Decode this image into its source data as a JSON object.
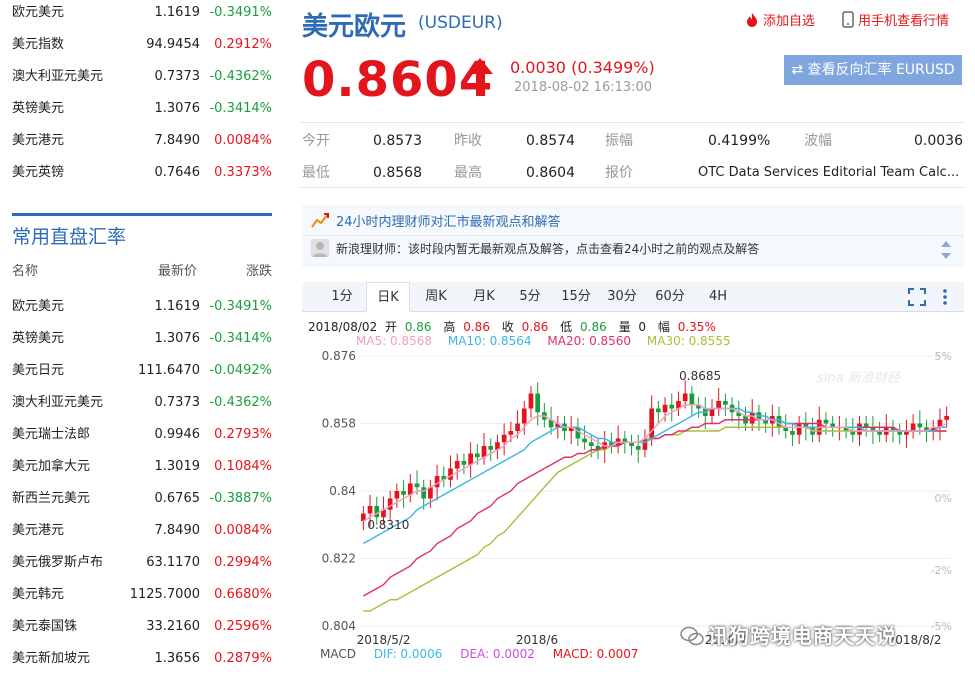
{
  "top_rates": [
    {
      "name": "欧元美元",
      "price": "1.1619",
      "change": "-0.3491%",
      "dir": "down"
    },
    {
      "name": "美元指数",
      "price": "94.9454",
      "change": "0.2912%",
      "dir": "up"
    },
    {
      "name": "澳大利亚元美元",
      "price": "0.7373",
      "change": "-0.4362%",
      "dir": "down"
    },
    {
      "name": "英镑美元",
      "price": "1.3076",
      "change": "-0.3414%",
      "dir": "down"
    },
    {
      "name": "美元港元",
      "price": "7.8490",
      "change": "0.0084%",
      "dir": "up"
    },
    {
      "name": "美元英镑",
      "price": "0.7646",
      "change": "0.3373%",
      "dir": "up"
    }
  ],
  "section_title": "常用直盘汇率",
  "columns": {
    "name": "名称",
    "price": "最新价",
    "change": "涨跌"
  },
  "direct_rates": [
    {
      "name": "欧元美元",
      "price": "1.1619",
      "change": "-0.3491%",
      "dir": "down"
    },
    {
      "name": "英镑美元",
      "price": "1.3076",
      "change": "-0.3414%",
      "dir": "down"
    },
    {
      "name": "美元日元",
      "price": "111.6470",
      "change": "-0.0492%",
      "dir": "down"
    },
    {
      "name": "澳大利亚元美元",
      "price": "0.7373",
      "change": "-0.4362%",
      "dir": "down"
    },
    {
      "name": "美元瑞士法郎",
      "price": "0.9946",
      "change": "0.2793%",
      "dir": "up"
    },
    {
      "name": "美元加拿大元",
      "price": "1.3019",
      "change": "0.1084%",
      "dir": "up"
    },
    {
      "name": "新西兰元美元",
      "price": "0.6765",
      "change": "-0.3887%",
      "dir": "down"
    },
    {
      "name": "美元港元",
      "price": "7.8490",
      "change": "0.0084%",
      "dir": "up"
    },
    {
      "name": "美元俄罗斯卢布",
      "price": "63.1170",
      "change": "0.2994%",
      "dir": "up"
    },
    {
      "name": "美元韩元",
      "price": "1125.7000",
      "change": "0.6680%",
      "dir": "up"
    },
    {
      "name": "美元泰国铢",
      "price": "33.2160",
      "change": "0.2596%",
      "dir": "up"
    },
    {
      "name": "美元新加坡元",
      "price": "1.3656",
      "change": "0.2879%",
      "dir": "up"
    }
  ],
  "header": {
    "title": "美元欧元",
    "code": "(USDEUR)",
    "add_fav": "添加自选",
    "mobile": "用手机查看行情"
  },
  "quote": {
    "price": "0.8604",
    "change": "0.0030 (0.3499%)",
    "datetime": "2018-08-02 16:13:00",
    "reverse_btn": "⇄ 查看反向汇率 EURUSD"
  },
  "stats": {
    "open_label": "今开",
    "open": "0.8573",
    "prev_close_label": "昨收",
    "prev_close": "0.8574",
    "amplitude_label": "振幅",
    "amplitude": "0.4199%",
    "wave_label": "波幅",
    "wave": "0.0036",
    "low_label": "最低",
    "low": "0.8568",
    "high_label": "最高",
    "high": "0.8604",
    "quote_label": "报价",
    "quote_src": "OTC Data Services Editorial Team Calc..."
  },
  "advice": {
    "title": "24小时内理财师对汇市最新观点和解答",
    "text": "新浪理财师：该时段内暂无最新观点及解答，点击查看24小时之前的观点及解答"
  },
  "tabs": [
    "1分",
    "日K",
    "周K",
    "月K",
    "5分",
    "15分",
    "30分",
    "60分",
    "4H"
  ],
  "active_tab": "日K",
  "ohlc": {
    "date": "2018/08/02",
    "open_label": "开",
    "open": "0.86",
    "high_label": "高",
    "high": "0.86",
    "close_label": "收",
    "close": "0.86",
    "low_label": "低",
    "low": "0.86",
    "vol_label": "量",
    "vol": "0",
    "amp_label": "幅",
    "amp": "0.35%"
  },
  "ma": {
    "ma5": "MA5: 0.8568",
    "ma10": "MA10: 0.8564",
    "ma20": "MA20: 0.8560",
    "ma30": "MA30: 0.8555"
  },
  "macd": {
    "label": "MACD",
    "dif": "DIF: 0.0006",
    "dea": "DEA: 0.0002",
    "macd": "MACD: 0.0007"
  },
  "chart_data": {
    "type": "candlestick",
    "y_ticks": [
      "0.876",
      "0.858",
      "0.84",
      "0.822",
      "0.804"
    ],
    "y_range": [
      0.804,
      0.876
    ],
    "pct_ticks": [
      "5%",
      "0%",
      "-2%",
      "-5%"
    ],
    "x_labels": [
      "2018/5/2",
      "2018/6",
      "2018/7",
      "2018/8/2"
    ],
    "annotations": {
      "high": "0.8685",
      "low": "0.8310"
    },
    "brand_mark": "sina 新浪财经",
    "colors": {
      "up": "#e4141c",
      "down": "#1a9e3b",
      "ma5": "#f19ec2",
      "ma10": "#3bb7e3",
      "ma20": "#e0306a",
      "ma30": "#a9c03c"
    },
    "closes": [
      0.834,
      0.836,
      0.833,
      0.835,
      0.838,
      0.84,
      0.839,
      0.842,
      0.841,
      0.838,
      0.841,
      0.844,
      0.843,
      0.846,
      0.848,
      0.847,
      0.85,
      0.849,
      0.852,
      0.851,
      0.853,
      0.855,
      0.856,
      0.858,
      0.862,
      0.866,
      0.861,
      0.859,
      0.857,
      0.858,
      0.856,
      0.857,
      0.854,
      0.853,
      0.852,
      0.851,
      0.853,
      0.852,
      0.854,
      0.853,
      0.852,
      0.851,
      0.854,
      0.862,
      0.861,
      0.863,
      0.862,
      0.864,
      0.866,
      0.863,
      0.862,
      0.86,
      0.862,
      0.864,
      0.863,
      0.861,
      0.86,
      0.858,
      0.861,
      0.859,
      0.858,
      0.86,
      0.857,
      0.856,
      0.855,
      0.858,
      0.857,
      0.855,
      0.859,
      0.858,
      0.857,
      0.857,
      0.856,
      0.855,
      0.858,
      0.857,
      0.856,
      0.855,
      0.857,
      0.856,
      0.855,
      0.856,
      0.858,
      0.857,
      0.856,
      0.857,
      0.859,
      0.86
    ],
    "ma5": [
      0.832,
      0.833,
      0.834,
      0.835,
      0.836,
      0.837,
      0.838,
      0.839,
      0.84,
      0.84,
      0.841,
      0.842,
      0.843,
      0.844,
      0.845,
      0.846,
      0.847,
      0.848,
      0.849,
      0.85,
      0.851,
      0.852,
      0.854,
      0.855,
      0.857,
      0.859,
      0.86,
      0.86,
      0.859,
      0.858,
      0.857,
      0.857,
      0.856,
      0.855,
      0.854,
      0.853,
      0.852,
      0.852,
      0.853,
      0.853,
      0.853,
      0.853,
      0.854,
      0.856,
      0.858,
      0.86,
      0.861,
      0.862,
      0.863,
      0.863,
      0.863,
      0.862,
      0.862,
      0.862,
      0.862,
      0.862,
      0.861,
      0.86,
      0.86,
      0.859,
      0.859,
      0.859,
      0.858,
      0.857,
      0.857,
      0.857,
      0.857,
      0.856,
      0.857,
      0.857,
      0.857,
      0.857,
      0.857,
      0.856,
      0.856,
      0.856,
      0.856,
      0.856,
      0.856,
      0.856,
      0.856,
      0.856,
      0.856,
      0.856,
      0.856,
      0.857,
      0.857,
      0.858
    ],
    "ma10": [
      0.826,
      0.827,
      0.828,
      0.829,
      0.83,
      0.831,
      0.832,
      0.833,
      0.835,
      0.836,
      0.837,
      0.838,
      0.839,
      0.84,
      0.841,
      0.842,
      0.843,
      0.844,
      0.845,
      0.846,
      0.847,
      0.848,
      0.849,
      0.85,
      0.851,
      0.853,
      0.854,
      0.855,
      0.856,
      0.857,
      0.857,
      0.857,
      0.857,
      0.856,
      0.855,
      0.854,
      0.854,
      0.853,
      0.853,
      0.853,
      0.853,
      0.853,
      0.853,
      0.854,
      0.855,
      0.856,
      0.857,
      0.858,
      0.859,
      0.86,
      0.861,
      0.861,
      0.862,
      0.862,
      0.862,
      0.862,
      0.862,
      0.861,
      0.861,
      0.86,
      0.86,
      0.859,
      0.859,
      0.858,
      0.858,
      0.857,
      0.857,
      0.857,
      0.857,
      0.857,
      0.857,
      0.857,
      0.857,
      0.857,
      0.857,
      0.856,
      0.856,
      0.856,
      0.856,
      0.856,
      0.856,
      0.856,
      0.856,
      0.856,
      0.856,
      0.856,
      0.857,
      0.857
    ],
    "ma20": [
      0.812,
      0.813,
      0.814,
      0.815,
      0.817,
      0.818,
      0.819,
      0.82,
      0.822,
      0.823,
      0.824,
      0.826,
      0.827,
      0.828,
      0.83,
      0.831,
      0.832,
      0.834,
      0.835,
      0.836,
      0.838,
      0.839,
      0.84,
      0.842,
      0.843,
      0.844,
      0.845,
      0.846,
      0.847,
      0.848,
      0.849,
      0.849,
      0.85,
      0.85,
      0.851,
      0.851,
      0.852,
      0.852,
      0.852,
      0.853,
      0.853,
      0.853,
      0.853,
      0.854,
      0.854,
      0.855,
      0.855,
      0.856,
      0.856,
      0.857,
      0.857,
      0.858,
      0.858,
      0.858,
      0.859,
      0.859,
      0.859,
      0.859,
      0.859,
      0.859,
      0.859,
      0.859,
      0.859,
      0.858,
      0.858,
      0.858,
      0.858,
      0.858,
      0.858,
      0.857,
      0.857,
      0.857,
      0.857,
      0.857,
      0.857,
      0.857,
      0.857,
      0.857,
      0.857,
      0.857,
      0.856,
      0.856,
      0.856,
      0.856,
      0.856,
      0.856,
      0.856,
      0.856
    ],
    "ma30": [
      0.808,
      0.808,
      0.809,
      0.81,
      0.811,
      0.811,
      0.812,
      0.813,
      0.814,
      0.815,
      0.816,
      0.817,
      0.818,
      0.819,
      0.82,
      0.821,
      0.822,
      0.823,
      0.825,
      0.826,
      0.828,
      0.829,
      0.831,
      0.833,
      0.835,
      0.837,
      0.839,
      0.841,
      0.843,
      0.845,
      0.846,
      0.847,
      0.848,
      0.849,
      0.85,
      0.851,
      0.851,
      0.852,
      0.852,
      0.853,
      0.853,
      0.853,
      0.854,
      0.854,
      0.854,
      0.855,
      0.855,
      0.855,
      0.856,
      0.856,
      0.856,
      0.856,
      0.856,
      0.856,
      0.857,
      0.857,
      0.857,
      0.857,
      0.857,
      0.857,
      0.857,
      0.857,
      0.857,
      0.857,
      0.857,
      0.857,
      0.857,
      0.856,
      0.856,
      0.856,
      0.856,
      0.856,
      0.856,
      0.856,
      0.856,
      0.856,
      0.856,
      0.856,
      0.856,
      0.856,
      0.856,
      0.856,
      0.856,
      0.856,
      0.856,
      0.856,
      0.856,
      0.856
    ]
  }
}
